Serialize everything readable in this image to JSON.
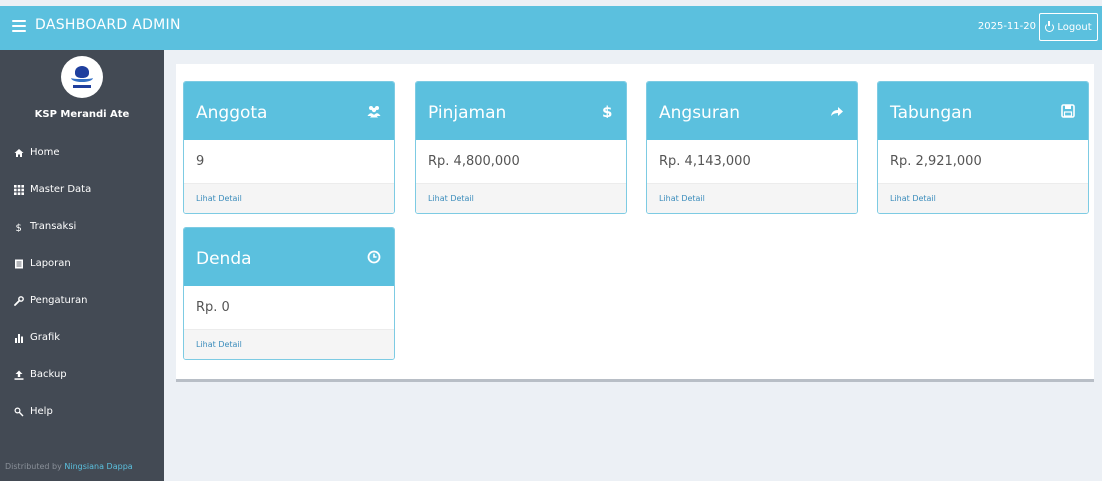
{
  "header": {
    "title": "DASHBOARD ADMIN",
    "date": "2025-11-20",
    "logout_label": "Logout"
  },
  "sidebar": {
    "org_name": "KSP Merandi Ate",
    "items": [
      {
        "label": "Home",
        "icon": "home-icon"
      },
      {
        "label": "Master Data",
        "icon": "grid-icon"
      },
      {
        "label": "Transaksi",
        "icon": "dollar-icon"
      },
      {
        "label": "Laporan",
        "icon": "report-icon"
      },
      {
        "label": "Pengaturan",
        "icon": "wrench-icon"
      },
      {
        "label": "Grafik",
        "icon": "bar-chart-icon"
      },
      {
        "label": "Backup",
        "icon": "upload-icon"
      },
      {
        "label": "Help",
        "icon": "help-icon"
      }
    ],
    "footer_prefix": "Distributed by",
    "footer_author": "Ningsiana Dappa"
  },
  "cards": [
    {
      "title": "Anggota",
      "value": "9",
      "link": "Lihat Detail",
      "icon": "users-icon"
    },
    {
      "title": "Pinjaman",
      "value": "Rp. 4,800,000",
      "link": "Lihat Detail",
      "icon": "dollar-icon"
    },
    {
      "title": "Angsuran",
      "value": "Rp. 4,143,000",
      "link": "Lihat Detail",
      "icon": "share-arrow-icon"
    },
    {
      "title": "Tabungan",
      "value": "Rp. 2,921,000",
      "link": "Lihat Detail",
      "icon": "save-icon"
    },
    {
      "title": "Denda",
      "value": "Rp. 0",
      "link": "Lihat Detail",
      "icon": "clock-icon"
    }
  ],
  "colors": {
    "accent": "#5bc0de",
    "sidebar": "#434a54",
    "link": "#3c8dbc"
  }
}
